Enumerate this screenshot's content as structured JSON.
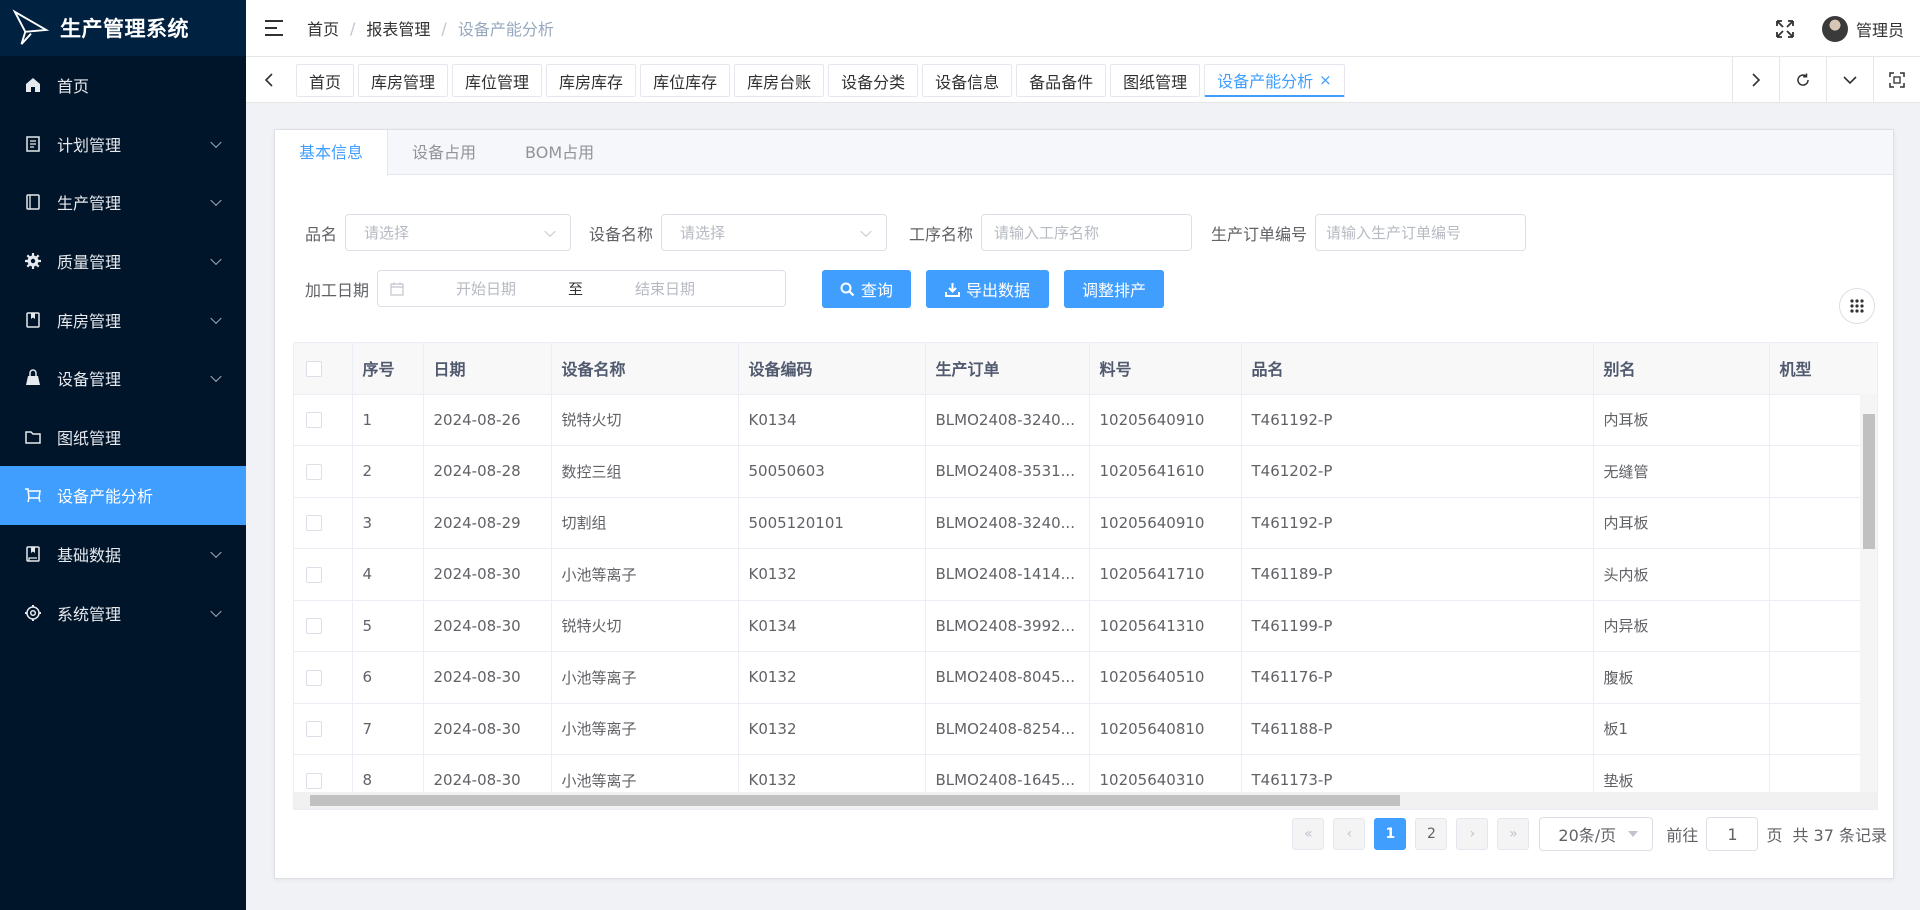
{
  "app": {
    "title": "生产管理系统"
  },
  "sidebar": {
    "items": [
      {
        "label": "首页",
        "icon": "home-icon",
        "expandable": false,
        "active": false
      },
      {
        "label": "计划管理",
        "icon": "plan-icon",
        "expandable": true,
        "active": false
      },
      {
        "label": "生产管理",
        "icon": "production-icon",
        "expandable": true,
        "active": false
      },
      {
        "label": "质量管理",
        "icon": "gear-icon",
        "expandable": true,
        "active": false
      },
      {
        "label": "库房管理",
        "icon": "warehouse-icon",
        "expandable": true,
        "active": false
      },
      {
        "label": "设备管理",
        "icon": "device-icon",
        "expandable": true,
        "active": false
      },
      {
        "label": "图纸管理",
        "icon": "folder-icon",
        "expandable": false,
        "active": false
      },
      {
        "label": "设备产能分析",
        "icon": "cart-icon",
        "expandable": false,
        "active": true
      },
      {
        "label": "基础数据",
        "icon": "book-icon",
        "expandable": true,
        "active": false
      },
      {
        "label": "系统管理",
        "icon": "settings-icon",
        "expandable": true,
        "active": false
      }
    ]
  },
  "header": {
    "breadcrumb": [
      "首页",
      "报表管理",
      "设备产能分析"
    ],
    "user": "管理员"
  },
  "tags": [
    "首页",
    "库房管理",
    "库位管理",
    "库房库存",
    "库位库存",
    "库房台账",
    "设备分类",
    "设备信息",
    "备品备件",
    "图纸管理",
    "设备产能分析"
  ],
  "tabs": [
    "基本信息",
    "设备占用",
    "BOM占用"
  ],
  "filters": {
    "product_label": "品名",
    "product_placeholder": "请选择",
    "device_label": "设备名称",
    "device_placeholder": "请选择",
    "process_label": "工序名称",
    "process_placeholder": "请输入工序名称",
    "order_label": "生产订单编号",
    "order_placeholder": "请输入生产订单编号",
    "date_label": "加工日期",
    "date_start": "开始日期",
    "date_sep": "至",
    "date_end": "结束日期"
  },
  "buttons": {
    "query": "查询",
    "export": "导出数据",
    "adjust": "调整排产"
  },
  "table": {
    "columns": [
      "序号",
      "日期",
      "设备名称",
      "设备编码",
      "生产订单",
      "料号",
      "品名",
      "别名",
      "机型"
    ],
    "rows": [
      [
        "1",
        "2024-08-26",
        "锐特火切",
        "K0134",
        "BLMO2408-3240...",
        "10205640910",
        "T461192-P",
        "内耳板",
        ""
      ],
      [
        "2",
        "2024-08-28",
        "数控三组",
        "50050603",
        "BLMO2408-3531...",
        "10205641610",
        "T461202-P",
        "无缝管",
        ""
      ],
      [
        "3",
        "2024-08-29",
        "切割组",
        "5005120101",
        "BLMO2408-3240...",
        "10205640910",
        "T461192-P",
        "内耳板",
        ""
      ],
      [
        "4",
        "2024-08-30",
        "小池等离子",
        "K0132",
        "BLMO2408-1414...",
        "10205641710",
        "T461189-P",
        "头内板",
        ""
      ],
      [
        "5",
        "2024-08-30",
        "锐特火切",
        "K0134",
        "BLMO2408-3992...",
        "10205641310",
        "T461199-P",
        "内异板",
        ""
      ],
      [
        "6",
        "2024-08-30",
        "小池等离子",
        "K0132",
        "BLMO2408-8045...",
        "10205640510",
        "T461176-P",
        "腹板",
        ""
      ],
      [
        "7",
        "2024-08-30",
        "小池等离子",
        "K0132",
        "BLMO2408-8254...",
        "10205640810",
        "T461188-P",
        "板1",
        ""
      ],
      [
        "8",
        "2024-08-30",
        "小池等离子",
        "K0132",
        "BLMO2408-1645...",
        "10205640310",
        "T461173-P",
        "垫板",
        ""
      ]
    ]
  },
  "pagination": {
    "pages": [
      "1",
      "2"
    ],
    "current": "1",
    "page_size": "20条/页",
    "goto_label": "前往",
    "goto_value": "1",
    "page_suffix": "页",
    "total": "共 37 条记录"
  },
  "colors": {
    "primary": "#409eff",
    "sidebar_bg": "#001529",
    "logo_bg": "#002140"
  }
}
